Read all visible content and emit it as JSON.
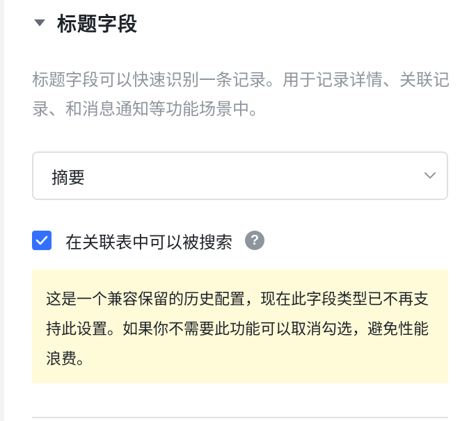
{
  "section": {
    "title": "标题字段",
    "collapse_icon": "caret-down-icon",
    "description": "标题字段可以快速识别一条记录。用于记录详情、关联记录、和消息通知等功能场景中。"
  },
  "title_field_select": {
    "value": "摘要",
    "icon": "chevron-down-icon"
  },
  "searchable_option": {
    "label": "在关联表中可以被搜索",
    "checked": true,
    "help_icon": "question-circle-icon",
    "help_glyph": "?"
  },
  "notice": {
    "text": "这是一个兼容保留的历史配置，现在此字段类型已不再支持此设置。如果你不需要此功能可以取消勾选，避免性能浪费。"
  },
  "colors": {
    "accent": "#3370ff",
    "notice_bg": "#fffbd9",
    "muted_text": "#8f959e",
    "border": "#dee0e3"
  }
}
